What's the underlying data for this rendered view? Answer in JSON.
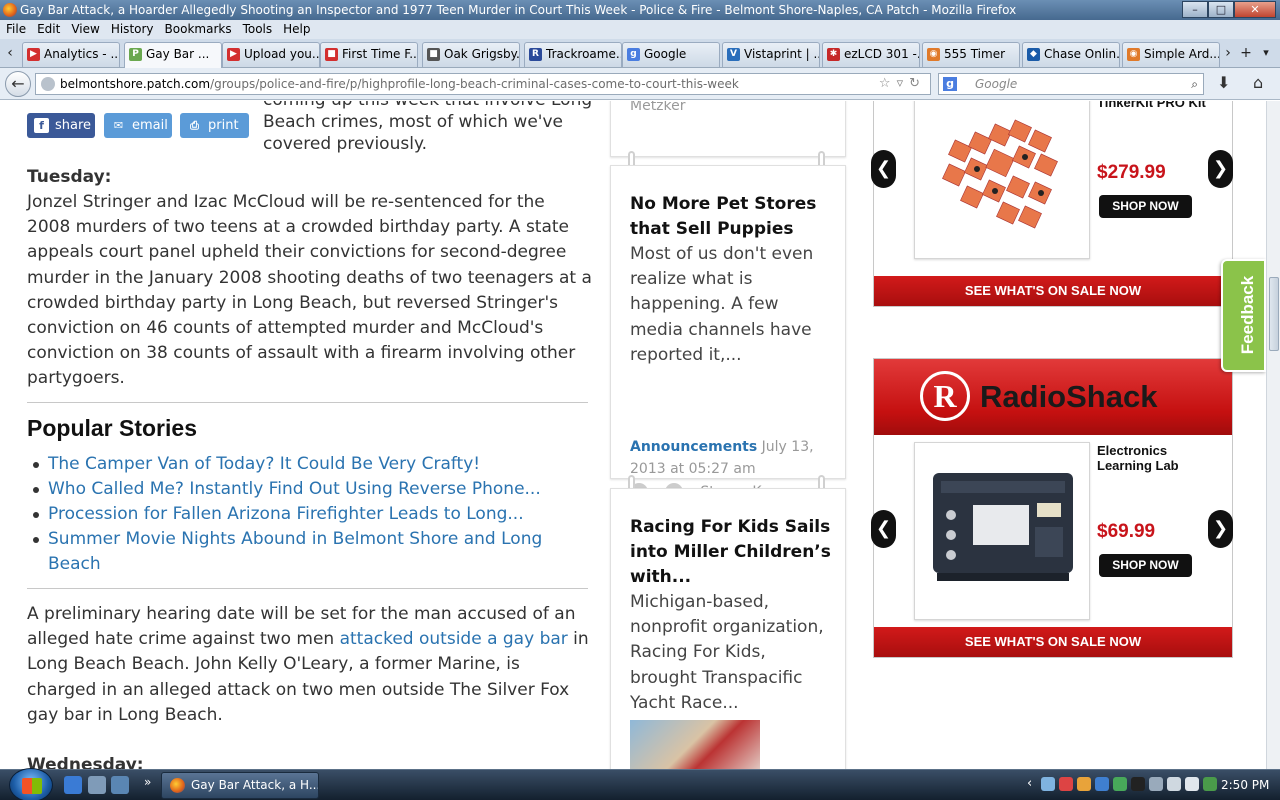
{
  "window": {
    "title": "Gay Bar Attack, a Hoarder Allegedly Shooting an Inspector and 1977 Teen Murder in Court This Week - Police & Fire - Belmont Shore-Naples, CA Patch - Mozilla Firefox",
    "controls": [
      "–",
      "□",
      "✕"
    ]
  },
  "menu": [
    "File",
    "Edit",
    "View",
    "History",
    "Bookmarks",
    "Tools",
    "Help"
  ],
  "tabs": [
    {
      "label": "Analytics - ...",
      "color": "#d32f2f",
      "glyph": "▶"
    },
    {
      "label": "Gay Bar ...",
      "color": "#6aa84f",
      "glyph": "P"
    },
    {
      "label": "Upload you...",
      "color": "#d32f2f",
      "glyph": "▶"
    },
    {
      "label": "First Time F...",
      "color": "#d32f2f",
      "glyph": "■"
    },
    {
      "label": "Oak Grigsby...",
      "color": "#555555",
      "glyph": "■"
    },
    {
      "label": "Trackroame...",
      "color": "#2b4a9a",
      "glyph": "R"
    },
    {
      "label": "Google",
      "color": "#4a7de0",
      "glyph": "g"
    },
    {
      "label": "Vistaprint | ...",
      "color": "#2a6ebb",
      "glyph": "V"
    },
    {
      "label": "ezLCD 301 -...",
      "color": "#c62828",
      "glyph": "✱"
    },
    {
      "label": "555 Timer",
      "color": "#e07a2a",
      "glyph": "◉"
    },
    {
      "label": "Chase Onlin...",
      "color": "#1a5ba8",
      "glyph": "◆"
    },
    {
      "label": "Simple Ard...",
      "color": "#e07a2a",
      "glyph": "◉"
    }
  ],
  "nav": {
    "url_domain": "belmontshore.patch.com",
    "url_path": "/groups/police-and-fire/p/highprofile-long-beach-criminal-cases-come-to-court-this-week",
    "search_placeholder": "Google",
    "search_engine": "g"
  },
  "article": {
    "share_buttons": [
      {
        "label": "share",
        "icon": "f",
        "color": "#3b5998"
      },
      {
        "label": "email",
        "icon": "✉",
        "color": "#4a8fd4"
      },
      {
        "label": "print",
        "icon": "⎙",
        "color": "#4a8fd4"
      }
    ],
    "intro": "coming up this week that involve Long Beach crimes, most of which we've covered previously.",
    "tuesday_label": "Tuesday:",
    "tuesday_text": "Jonzel Stringer and Izac McCloud will be re-sentenced for the 2008 murders of two teens at a crowded birthday party. A state appeals court panel upheld their convictions for second-degree murder in the January 2008 shooting deaths of two teenagers at a crowded birthday party in Long Beach, but reversed Stringer's conviction on 46 counts of attempted murder and McCloud's conviction on 38 counts of assault with a firearm involving other partygoers.",
    "popular_title": "Popular Stories",
    "popular": [
      "The Camper Van of Today? It Could Be Very Crafty!",
      "Who Called Me? Instantly Find Out Using Reverse Phone...",
      "Procession for Fallen Arizona Firefighter Leads to Long...",
      "Summer Movie Nights Abound in Belmont Shore and Long Beach"
    ],
    "hearing_before": "A preliminary hearing date will be set for the man accused of an alleged hate crime against two men ",
    "hearing_link": "attacked outside a gay bar",
    "hearing_after": " in Long Beach Beach. John Kelly O'Leary, a former Marine, is charged in an alleged attack on two men outside The Silver Fox gay bar in Long Beach.",
    "wednesday_label": "Wednesday:"
  },
  "sidebar": {
    "top_author": "Metzker",
    "card1": {
      "title": "No More Pet Stores that Sell Puppies",
      "text": "Most of us don't even realize what is happening. A few media channels have reported it,...",
      "category": "Announcements",
      "date": "July 13, 2013 at 05:27 am",
      "author": "• Stacey Kranz"
    },
    "card2": {
      "title": "Racing For Kids Sails into Miller Children’s with...",
      "text": "Michigan-based, nonprofit organization, Racing For Kids, brought Transpacific Yacht Race..."
    }
  },
  "ads": {
    "ad1": {
      "product": "TinkerKit PRO Kit",
      "price": "$279.99",
      "shop": "SHOP NOW",
      "bar": "SEE WHAT'S ON SALE NOW"
    },
    "ad2": {
      "brand": "RadioShack",
      "brand_mark": "R",
      "product": "Electronics Learning Lab",
      "price": "$69.99",
      "shop": "SHOP NOW",
      "bar": "SEE WHAT'S ON SALE NOW"
    },
    "arrow_left": "❮",
    "arrow_right": "❯"
  },
  "feedback": "Feedback",
  "taskbar": {
    "active_window": "Gay Bar Attack, a H...",
    "clock": "2:50 PM",
    "expand": "»",
    "tray_chevron": "‹"
  }
}
